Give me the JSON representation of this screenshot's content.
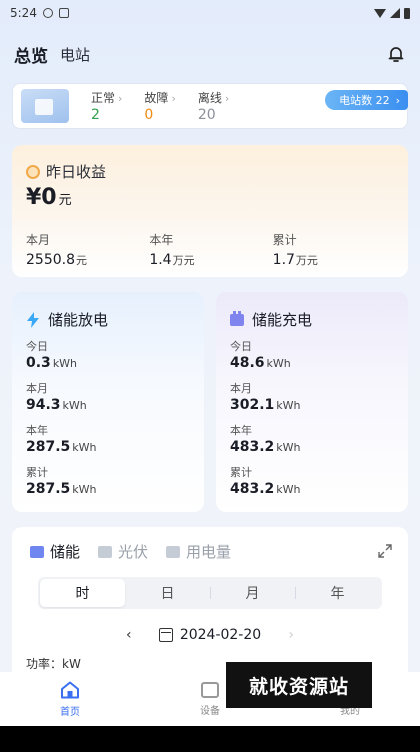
{
  "status_bar": {
    "time": "5:24"
  },
  "header": {
    "title": "总览",
    "subtitle": "电站"
  },
  "station_summary": {
    "normal_label": "正常",
    "normal_count": "2",
    "fault_label": "故障",
    "fault_count": "0",
    "offline_label": "离线",
    "offline_count": "20",
    "station_count_label": "电站数 22"
  },
  "earnings": {
    "title": "昨日收益",
    "amount": "¥0",
    "amount_unit": "元",
    "month_label": "本月",
    "month_value": "2550.8",
    "month_unit": "元",
    "year_label": "本年",
    "year_value": "1.4",
    "year_unit": "万元",
    "total_label": "累计",
    "total_value": "1.7",
    "total_unit": "万元"
  },
  "discharge": {
    "title": "储能放电",
    "rows": [
      {
        "label": "今日",
        "value": "0.3",
        "unit": "kWh"
      },
      {
        "label": "本月",
        "value": "94.3",
        "unit": "kWh"
      },
      {
        "label": "本年",
        "value": "287.5",
        "unit": "kWh"
      },
      {
        "label": "累计",
        "value": "287.5",
        "unit": "kWh"
      }
    ]
  },
  "charge": {
    "title": "储能充电",
    "rows": [
      {
        "label": "今日",
        "value": "48.6",
        "unit": "kWh"
      },
      {
        "label": "本月",
        "value": "302.1",
        "unit": "kWh"
      },
      {
        "label": "本年",
        "value": "483.2",
        "unit": "kWh"
      },
      {
        "label": "累计",
        "value": "483.2",
        "unit": "kWh"
      }
    ]
  },
  "chart_panel": {
    "tabs": [
      "储能",
      "光伏",
      "用电量"
    ],
    "active_tab": "储能",
    "periods": [
      "时",
      "日",
      "月",
      "年"
    ],
    "active_period": "时",
    "date": "2024-02-20",
    "power_label": "功率：kW"
  },
  "bottom_nav": {
    "home": "首页",
    "devices": "设备",
    "mine": "我的"
  },
  "watermark": "就收资源站",
  "colors": {
    "accent": "#3a6ff0",
    "green": "#2fa14a",
    "orange": "#f08a12",
    "bolt": "#3aa8f5"
  }
}
